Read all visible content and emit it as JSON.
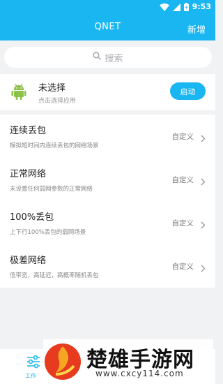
{
  "status_bar": {
    "time": "9:53",
    "icons": [
      "wifi-icon",
      "signal-icon",
      "battery-icon"
    ]
  },
  "header": {
    "title": "QNET",
    "action_label": "新增"
  },
  "search": {
    "placeholder": "搜索",
    "icon": "search-icon"
  },
  "app": {
    "icon": "android-icon",
    "title": "未选择",
    "subtitle": "点击选择应用",
    "start_label": "启动"
  },
  "modes": [
    {
      "title": "连续丢包",
      "desc": "模拟短时间内连续丢包的网络场景",
      "status": "自定义"
    },
    {
      "title": "正常网络",
      "desc": "未设置任何弱网参数的正常网络",
      "status": "自定义"
    },
    {
      "title": "100%丢包",
      "desc": "上下行100%丢包的弱网场景",
      "status": "自定义"
    },
    {
      "title": "极差网络",
      "desc": "低带宽，高延迟，高概率随机丢包",
      "status": "自定义"
    }
  ],
  "bottom_nav": {
    "tab_label": "工作",
    "tab_icon": "sliders-icon"
  },
  "watermark": {
    "title": "楚雄手游网",
    "url": "www.cxcy114.com"
  },
  "colors": {
    "accent": "#19b6f2",
    "android": "#8cc24a",
    "background": "#f1f2f4"
  }
}
